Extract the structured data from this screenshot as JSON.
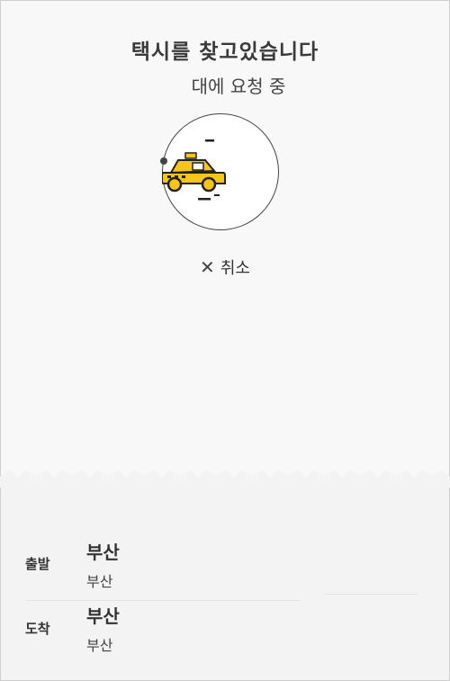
{
  "header": {
    "title": "택시를 찾고있습니다",
    "subtitle": "대에 요청 중"
  },
  "radar": {
    "icon": "taxi-icon",
    "accent": "#f5c518"
  },
  "cancel": {
    "icon": "close-icon",
    "label": "취소"
  },
  "route": {
    "departure": {
      "label": "출발",
      "name": "부산",
      "detail": "부산"
    },
    "arrival": {
      "label": "도착",
      "name": "부산",
      "detail": "부산"
    }
  }
}
